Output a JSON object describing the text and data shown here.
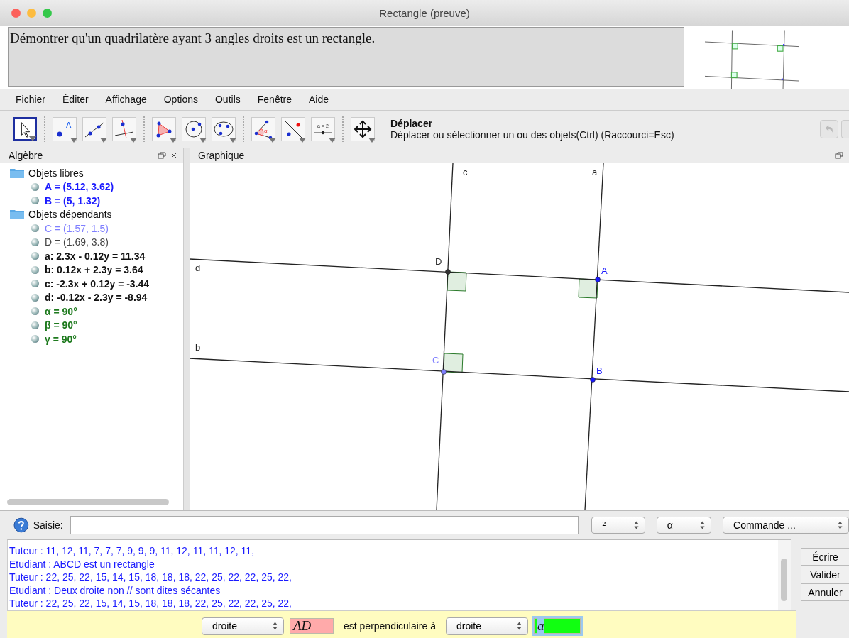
{
  "window": {
    "title": "Rectangle (preuve)"
  },
  "statement": "Démontrer qu'un quadrilatère ayant 3 angles droits est un rectangle.",
  "menu": [
    "Fichier",
    "Éditer",
    "Affichage",
    "Options",
    "Outils",
    "Fenêtre",
    "Aide"
  ],
  "toolbar": {
    "groups": [
      [
        {
          "kind": "move",
          "selected": true
        }
      ],
      [
        {
          "kind": "point",
          "selected": false,
          "label": "A"
        },
        {
          "kind": "line",
          "selected": false
        },
        {
          "kind": "perpendicular",
          "selected": false
        }
      ],
      [
        {
          "kind": "polygon",
          "selected": false
        },
        {
          "kind": "circle",
          "selected": false
        },
        {
          "kind": "conic",
          "selected": false
        }
      ],
      [
        {
          "kind": "angle",
          "selected": false,
          "label": "α"
        },
        {
          "kind": "reflect",
          "selected": false
        },
        {
          "kind": "slider",
          "selected": false,
          "label": "a = 2"
        }
      ],
      [
        {
          "kind": "pan",
          "selected": false
        }
      ]
    ],
    "tool_name": "Déplacer",
    "tool_help": "Déplacer ou sélectionner un ou des objets(Ctrl) (Raccourci=Esc)"
  },
  "algebra": {
    "title": "Algèbre",
    "groups": [
      {
        "label": "Objets libres",
        "children": [
          {
            "text": "A = (5.12, 3.62)",
            "color": "#1a1aff",
            "bold": true
          },
          {
            "text": "B = (5, 1.32)",
            "color": "#1a1aff",
            "bold": true
          }
        ]
      },
      {
        "label": "Objets dépendants",
        "children": [
          {
            "text": "C = (1.57, 1.5)",
            "color": "#7f7fff",
            "bold": false
          },
          {
            "text": "D = (1.69, 3.8)",
            "color": "#444444",
            "bold": false
          },
          {
            "text": "a: 2.3x - 0.12y = 11.34",
            "color": "#111111",
            "bold": true
          },
          {
            "text": "b: 0.12x + 2.3y = 3.64",
            "color": "#111111",
            "bold": true
          },
          {
            "text": "c: -2.3x + 0.12y = -3.44",
            "color": "#111111",
            "bold": true
          },
          {
            "text": "d: -0.12x - 2.3y = -8.94",
            "color": "#111111",
            "bold": true
          },
          {
            "text": "α = 90°",
            "color": "#1e7a1e",
            "bold": true
          },
          {
            "text": "β = 90°",
            "color": "#1e7a1e",
            "bold": true
          },
          {
            "text": "γ = 90°",
            "color": "#1e7a1e",
            "bold": true
          }
        ]
      }
    ]
  },
  "graphics": {
    "title": "Graphique",
    "lines": [
      {
        "name": "c"
      },
      {
        "name": "a"
      },
      {
        "name": "d"
      },
      {
        "name": "b"
      }
    ],
    "points": [
      {
        "name": "D",
        "color": "#333333"
      },
      {
        "name": "A",
        "color": "#1a1aff"
      },
      {
        "name": "C",
        "color": "#7f7fff"
      },
      {
        "name": "B",
        "color": "#1a1aff"
      }
    ]
  },
  "input_bar": {
    "label": "Saisie:",
    "selects": [
      "²",
      "α",
      "Commande ..."
    ]
  },
  "log": [
    "Tuteur : 11, 12, 11, 7, 7, 7, 9, 9, 9, 11, 12, 11, 11, 12, 11,",
    "Etudiant : ABCD est un rectangle",
    "Tuteur : 22, 25, 22, 15, 14, 15, 18, 18, 18, 22, 25, 22, 22, 25, 22,",
    "Etudiant : Deux droite non // sont dites sécantes",
    "Tuteur : 22, 25, 22, 15, 14, 15, 18, 18, 18, 22, 25, 22, 22, 25, 22,"
  ],
  "buttons": [
    "Écrire",
    "Valider",
    "Annuler"
  ],
  "answer": [
    {
      "kind": "select",
      "value": "droite"
    },
    {
      "kind": "field",
      "value": "AD",
      "color": "#ffaaaa",
      "focused": false
    },
    {
      "kind": "text",
      "value": "est perpendiculaire à"
    },
    {
      "kind": "select",
      "value": "droite"
    },
    {
      "kind": "field",
      "value": "a",
      "color": "#11ff11",
      "focused": true
    }
  ]
}
